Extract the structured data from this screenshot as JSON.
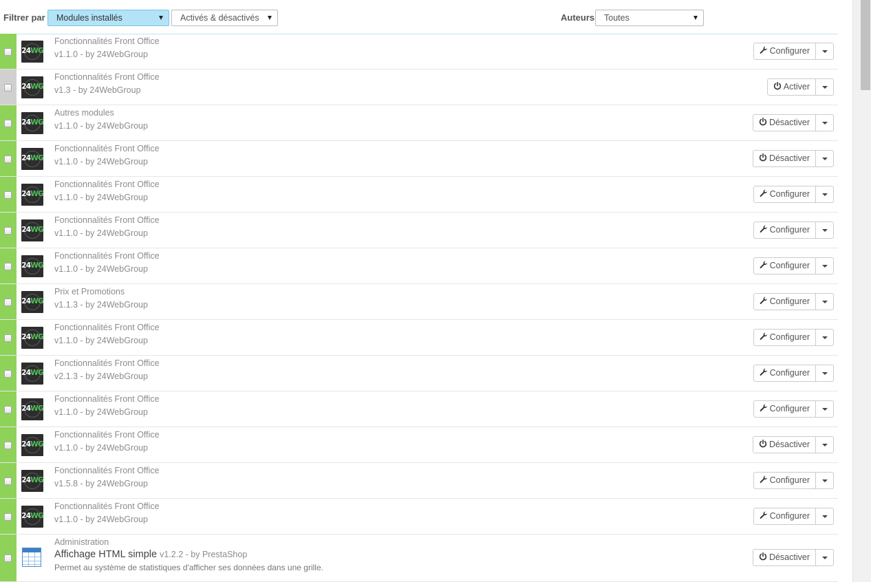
{
  "filters": {
    "label": "Filtrer par",
    "module_type": "Modules installés",
    "status": "Activés & désactivés",
    "authors_label": "Auteurs",
    "authors": "Toutes"
  },
  "logo_text": {
    "a": "24",
    "b": "WG"
  },
  "modules": [
    {
      "category": "Fonctionnalités Front Office",
      "version": "v1.1.0 - by 24WebGroup",
      "enabled": true,
      "action": "Configurer",
      "icon": "wrench-icon"
    },
    {
      "category": "Fonctionnalités Front Office",
      "version": "v1.3 - by 24WebGroup",
      "enabled": false,
      "action": "Activer",
      "icon": "power-icon"
    },
    {
      "category": "Autres modules",
      "version": "v1.1.0 - by 24WebGroup",
      "enabled": true,
      "action": "Désactiver",
      "icon": "power-icon"
    },
    {
      "category": "Fonctionnalités Front Office",
      "version": "v1.1.0 - by 24WebGroup",
      "enabled": true,
      "action": "Désactiver",
      "icon": "power-icon"
    },
    {
      "category": "Fonctionnalités Front Office",
      "version": "v1.1.0 - by 24WebGroup",
      "enabled": true,
      "action": "Configurer",
      "icon": "wrench-icon"
    },
    {
      "category": "Fonctionnalités Front Office",
      "version": "v1.1.0 - by 24WebGroup",
      "enabled": true,
      "action": "Configurer",
      "icon": "wrench-icon"
    },
    {
      "category": "Fonctionnalités Front Office",
      "version": "v1.1.0 - by 24WebGroup",
      "enabled": true,
      "action": "Configurer",
      "icon": "wrench-icon"
    },
    {
      "category": "Prix et Promotions",
      "version": "v1.1.3 - by 24WebGroup",
      "enabled": true,
      "action": "Configurer",
      "icon": "wrench-icon"
    },
    {
      "category": "Fonctionnalités Front Office",
      "version": "v1.1.0 - by 24WebGroup",
      "enabled": true,
      "action": "Configurer",
      "icon": "wrench-icon"
    },
    {
      "category": "Fonctionnalités Front Office",
      "version": "v2.1.3 - by 24WebGroup",
      "enabled": true,
      "action": "Configurer",
      "icon": "wrench-icon"
    },
    {
      "category": "Fonctionnalités Front Office",
      "version": "v1.1.0 - by 24WebGroup",
      "enabled": true,
      "action": "Configurer",
      "icon": "wrench-icon"
    },
    {
      "category": "Fonctionnalités Front Office",
      "version": "v1.1.0 - by 24WebGroup",
      "enabled": true,
      "action": "Désactiver",
      "icon": "power-icon"
    },
    {
      "category": "Fonctionnalités Front Office",
      "version": "v1.5.8 - by 24WebGroup",
      "enabled": true,
      "action": "Configurer",
      "icon": "wrench-icon"
    },
    {
      "category": "Fonctionnalités Front Office",
      "version": "v1.1.0 - by 24WebGroup",
      "enabled": true,
      "action": "Configurer",
      "icon": "wrench-icon"
    }
  ],
  "last_module": {
    "category": "Administration",
    "name": "Affichage HTML simple",
    "version": "v1.2.2 - by PrestaShop",
    "description": "Permet au système de statistiques d'afficher ses données dans une grille.",
    "enabled": true,
    "action": "Désactiver",
    "icon": "power-icon"
  }
}
